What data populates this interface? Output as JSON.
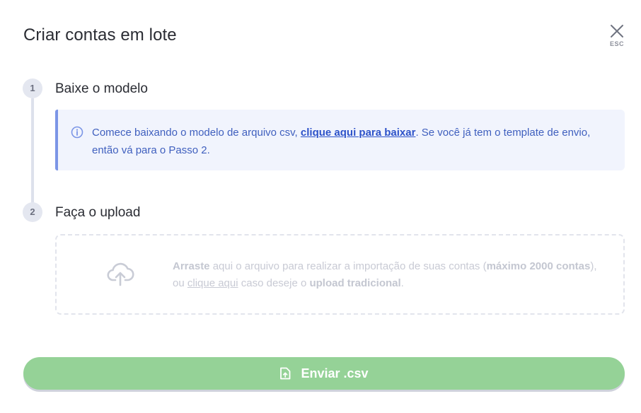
{
  "modal": {
    "title": "Criar contas em lote",
    "close_hint": "ESC"
  },
  "steps": [
    {
      "number": "1",
      "title": "Baixe o modelo"
    },
    {
      "number": "2",
      "title": "Faça o upload"
    }
  ],
  "info": {
    "icon": "info-icon",
    "text_before": "Comece baixando o modelo de arquivo csv, ",
    "link": "clique aqui para baixar",
    "text_after": ". Se você já tem o template de envio, então vá para o Passo 2."
  },
  "dropzone": {
    "icon": "cloud-upload-icon",
    "drag_bold": "Arraste",
    "drag_text": " aqui o arquivo para realizar a importação de suas contas (",
    "max_bold": "máximo 2000 contas",
    "mid_text": "), ou ",
    "link": "clique aqui",
    "after_link": " caso deseje o ",
    "traditional_bold": "upload tradicional",
    "end": "."
  },
  "submit": {
    "label": "Enviar .csv",
    "icon": "file-upload-icon"
  },
  "colors": {
    "accent_info": "#7b95e6",
    "info_bg": "#f1f4fd",
    "submit_bg": "#95d297"
  }
}
